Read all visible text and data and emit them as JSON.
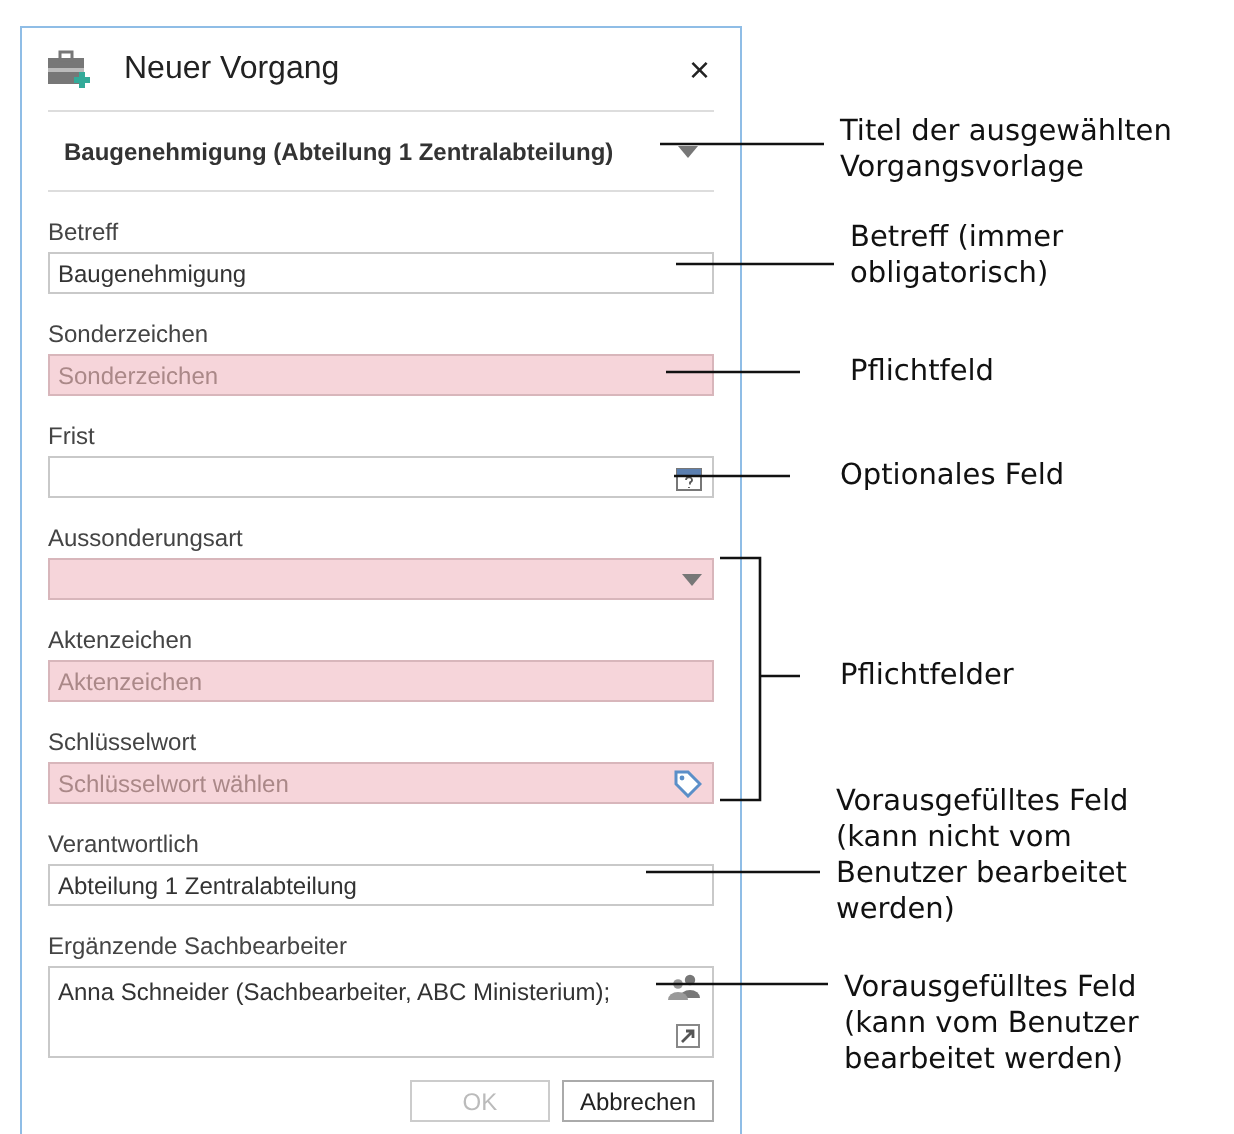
{
  "dialog": {
    "title": "Neuer Vorgang",
    "close": "×",
    "template": "Baugenehmigung (Abteilung 1 Zentralabteilung)",
    "fields": [
      {
        "kind": "text",
        "label": "Betreff",
        "value": "Baugenehmigung",
        "required": false
      },
      {
        "kind": "text",
        "label": "Sonderzeichen",
        "placeholder": "Sonderzeichen",
        "required": true
      },
      {
        "kind": "date",
        "label": "Frist",
        "required": false
      },
      {
        "kind": "select",
        "label": "Aussonderungsart",
        "required": true
      },
      {
        "kind": "text",
        "label": "Aktenzeichen",
        "placeholder": "Aktenzeichen",
        "required": true
      },
      {
        "kind": "keyword",
        "label": "Schlüsselwort",
        "placeholder": "Schlüsselwort wählen",
        "required": true
      },
      {
        "kind": "text",
        "label": "Verantwortlich",
        "value": "Abteilung 1 Zentralabteilung",
        "required": false
      },
      {
        "kind": "people",
        "label": "Ergänzende Sachbearbeiter",
        "value": "Anna Schneider (Sachbearbeiter, ABC Ministerium);",
        "required": false
      }
    ],
    "buttons": [
      {
        "label": "OK",
        "disabled": true
      },
      {
        "label": "Abbrechen",
        "disabled": false
      }
    ]
  },
  "annotations": [
    {
      "kind": "line",
      "lines": [
        "Titel der ausgewählten",
        "Vorgangsvorlage"
      ]
    },
    {
      "kind": "line",
      "lines": [
        "Betreff (immer",
        "obligatorisch)"
      ]
    },
    {
      "kind": "line",
      "lines": [
        "Pflichtfeld"
      ]
    },
    {
      "kind": "line",
      "lines": [
        "Optionales Feld"
      ]
    },
    {
      "kind": "bracket",
      "lines": [
        "Pflichtfelder"
      ]
    },
    {
      "kind": "line",
      "lines": [
        "Vorausgefülltes Feld",
        "(kann nicht vom",
        "Benutzer bearbeitet",
        "werden)"
      ]
    },
    {
      "kind": "line",
      "lines": [
        "Vorausgefülltes Feld",
        "(kann vom Benutzer",
        "bearbeitet werden)"
      ]
    }
  ]
}
